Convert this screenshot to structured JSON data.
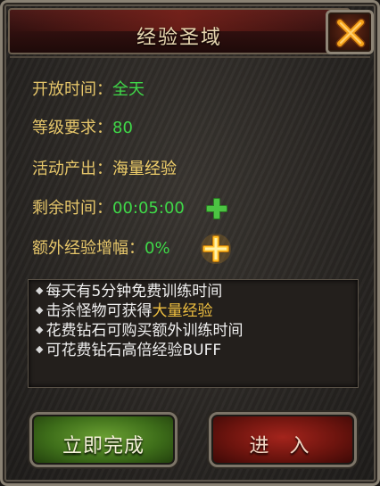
{
  "window": {
    "title": "经验圣域"
  },
  "info": {
    "open_time_label": "开放时间：",
    "open_time_value": "全天",
    "level_label": "等级要求：",
    "level_value": "80",
    "output_label": "活动产出：",
    "output_value": "海量经验",
    "remaining_label": "剩余时间：",
    "remaining_value": "00:05:00",
    "bonus_label": "额外经验增幅：",
    "bonus_value": "0%"
  },
  "notes": {
    "line1": "每天有5分钟免费训练时间",
    "line2_prefix": "击杀怪物可获得",
    "line2_highlight": "大量经验",
    "line3": "花费钻石可购买额外训练时间",
    "line4": "可花费钻石高倍经验BUFF",
    "bullet": "◆"
  },
  "buttons": {
    "complete": "立即完成",
    "enter": "进 入"
  },
  "colors": {
    "label": "#e6c66a",
    "value_green": "#3fd848",
    "highlight": "#f0c040",
    "plus_green": "#3db23a",
    "plus_gold": "#f2b622"
  }
}
